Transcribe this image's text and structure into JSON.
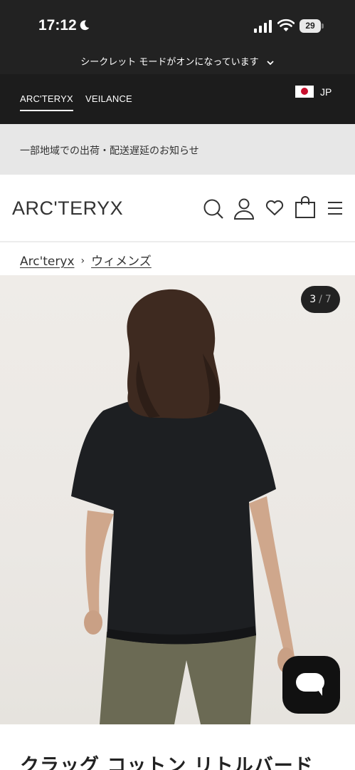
{
  "status_bar": {
    "time": "17:12",
    "battery": "29",
    "icons": [
      "moon-icon",
      "signal-icon",
      "wifi-icon",
      "battery-icon"
    ]
  },
  "incognito": {
    "message": "シークレット モードがオンになっています"
  },
  "brand_bar": {
    "tabs": [
      {
        "label": "ARC'TERYX",
        "active": true
      },
      {
        "label": "VEILANCE",
        "active": false
      }
    ],
    "country": "JP"
  },
  "notice": {
    "text": "一部地域での出荷・配送遅延のお知らせ"
  },
  "header": {
    "logo": "ARC'TERYX",
    "icons": [
      "search-icon",
      "account-icon",
      "wishlist-heart-icon",
      "cart-bag-icon",
      "menu-icon"
    ]
  },
  "breadcrumb": {
    "items": [
      "Arc'teryx",
      "ウィメンズ"
    ]
  },
  "gallery": {
    "current": "3",
    "separator": "/",
    "total": "7"
  },
  "product": {
    "title": "クラッグ コットン リトルバード"
  },
  "colors": {
    "dark_bar": "#222222",
    "notice_bg": "#e7e7e7",
    "flag_red": "#c8102e"
  }
}
